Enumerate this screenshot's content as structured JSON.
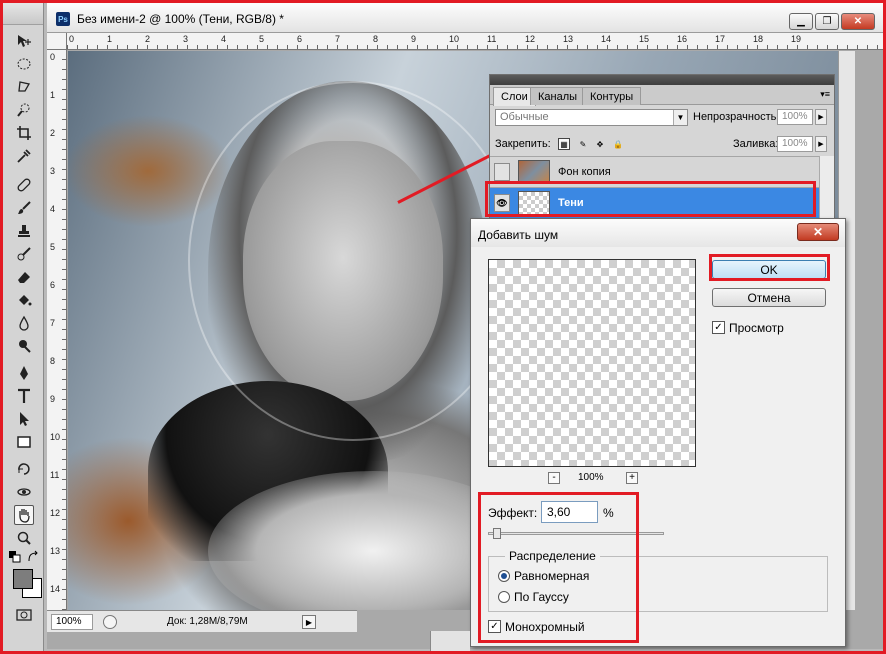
{
  "document": {
    "title": "Без имени-2 @ 100% (Тени, RGB/8) *",
    "app_icon": "Ps",
    "zoom": "100%",
    "doc_info": "Док: 1,28M/8,79M",
    "ruler_h": [
      "0",
      "1",
      "2",
      "3",
      "4",
      "5",
      "6",
      "7",
      "8",
      "9",
      "10",
      "11",
      "12",
      "13",
      "14",
      "15",
      "16",
      "17",
      "18",
      "19"
    ],
    "ruler_v": [
      "0",
      "1",
      "2",
      "3",
      "4",
      "5",
      "6",
      "7",
      "8",
      "9",
      "10",
      "11",
      "12",
      "13",
      "14"
    ]
  },
  "window_controls": {
    "minimize": "▁",
    "restore": "❐",
    "close": "✕"
  },
  "toolbox": {
    "tools": [
      "move-tool-icon",
      "marquee-tool-icon",
      "lasso-tool-icon",
      "quick-selection-tool-icon",
      "crop-tool-icon",
      "eyedropper-tool-icon",
      "healing-brush-icon",
      "brush-tool-icon",
      "clone-stamp-icon",
      "history-brush-icon",
      "eraser-tool-icon",
      "paint-bucket-icon",
      "blur-tool-icon",
      "dodge-tool-icon",
      "pen-tool-icon",
      "type-tool-icon",
      "path-selection-icon",
      "shape-tool-icon",
      "3d-rotate-icon",
      "3d-orbit-icon",
      "hand-tool-icon",
      "zoom-tool-icon"
    ],
    "active_tool": "hand-tool-icon"
  },
  "layers_panel": {
    "tabs": [
      "Слои",
      "Каналы",
      "Контуры"
    ],
    "active_tab": "Слои",
    "blend_mode": "Обычные",
    "opacity_label": "Непрозрачность:",
    "opacity_value": "100%",
    "lock_label": "Закрепить:",
    "fill_label": "Заливка:",
    "fill_value": "100%",
    "layers": [
      {
        "name": "Фон копия",
        "visible": false,
        "thumb": "photo"
      },
      {
        "name": "Тени",
        "visible": true,
        "thumb": "transparent",
        "selected": true
      }
    ]
  },
  "dialog": {
    "title": "Добавить шум",
    "close_label": "✕",
    "ok_label": "OK",
    "cancel_label": "Отмена",
    "preview_label": "Просмотр",
    "preview_checked": true,
    "zoom_minus": "-",
    "zoom_plus": "+",
    "preview_zoom": "100%",
    "amount_label": "Эффект:",
    "amount_value": "3,60",
    "amount_unit": "%",
    "amount_slider_fraction": 0.02,
    "distribution_label": "Распределение",
    "distribution_options": [
      "Равномерная",
      "По Гауссу"
    ],
    "distribution_selected": "Равномерная",
    "monochrome_label": "Монохромный",
    "monochrome_checked": true
  },
  "colors": {
    "annotation_red": "#e21b24",
    "selection_blue": "#3b88e3"
  }
}
